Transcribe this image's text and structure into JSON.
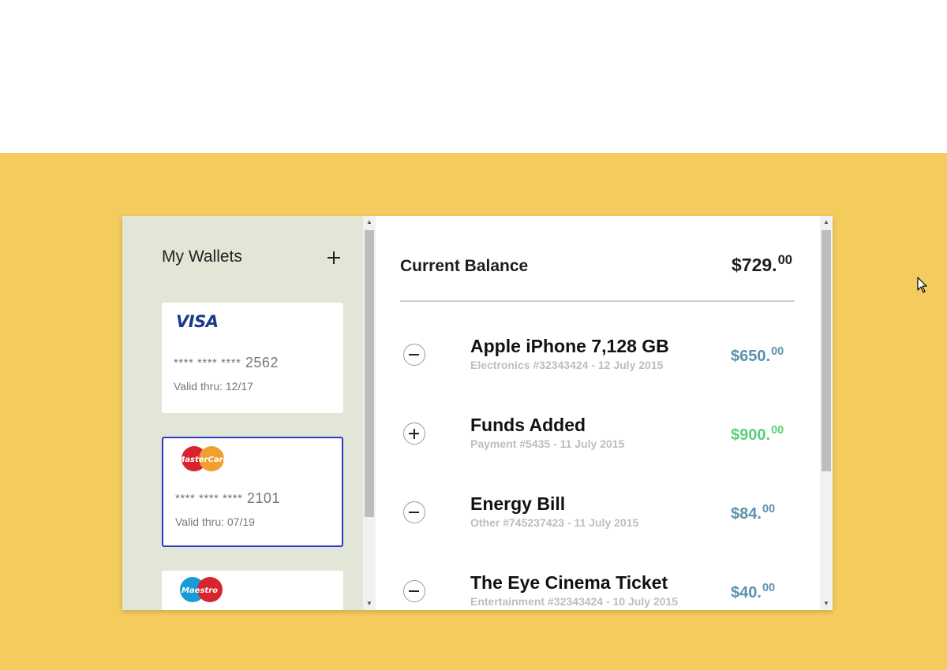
{
  "wallets": {
    "title": "My Wallets",
    "add_icon": "plus-icon",
    "cards": [
      {
        "brand": "VISA",
        "logo_icon": "visa-logo",
        "masked": "**** **** ****",
        "last4": "2562",
        "valid": "Valid thru: 12/17",
        "selected": false
      },
      {
        "brand": "MasterCard",
        "logo_icon": "mastercard-logo",
        "masked": "**** **** ****",
        "last4": "2101",
        "valid": "Valid thru: 07/19",
        "selected": true
      },
      {
        "brand": "Maestro",
        "logo_icon": "maestro-logo",
        "selected": false
      }
    ]
  },
  "balance": {
    "label": "Current Balance",
    "amount": "$729.",
    "cents": "00"
  },
  "transactions": [
    {
      "icon": "minus-icon",
      "title": "Apple iPhone 7,128 GB",
      "sub": "Electronics #32343424 - 12 July 2015",
      "amount": "$650.",
      "cents": "00",
      "color": "#5a93ad"
    },
    {
      "icon": "plus-icon",
      "title": "Funds Added",
      "sub": "Payment #5435 - 11 July 2015",
      "amount": "$900.",
      "cents": "00",
      "color": "#5ad07a"
    },
    {
      "icon": "minus-icon",
      "title": "Energy Bill",
      "sub": "Other #745237423 - 11 July 2015",
      "amount": "$84.",
      "cents": "00",
      "color": "#5a93ad"
    },
    {
      "icon": "minus-icon",
      "title": "The Eye Cinema Ticket",
      "sub": "Entertainment #32343424 - 10 July 2015",
      "amount": "$40.",
      "cents": "00",
      "color": "#5a93ad"
    }
  ],
  "colors": {
    "background_band": "#f4cc5e",
    "wallet_panel": "#e1e6d7",
    "selected_card_border": "#2d3bc7",
    "debit_amount": "#5a93ad",
    "credit_amount": "#5ad07a"
  }
}
